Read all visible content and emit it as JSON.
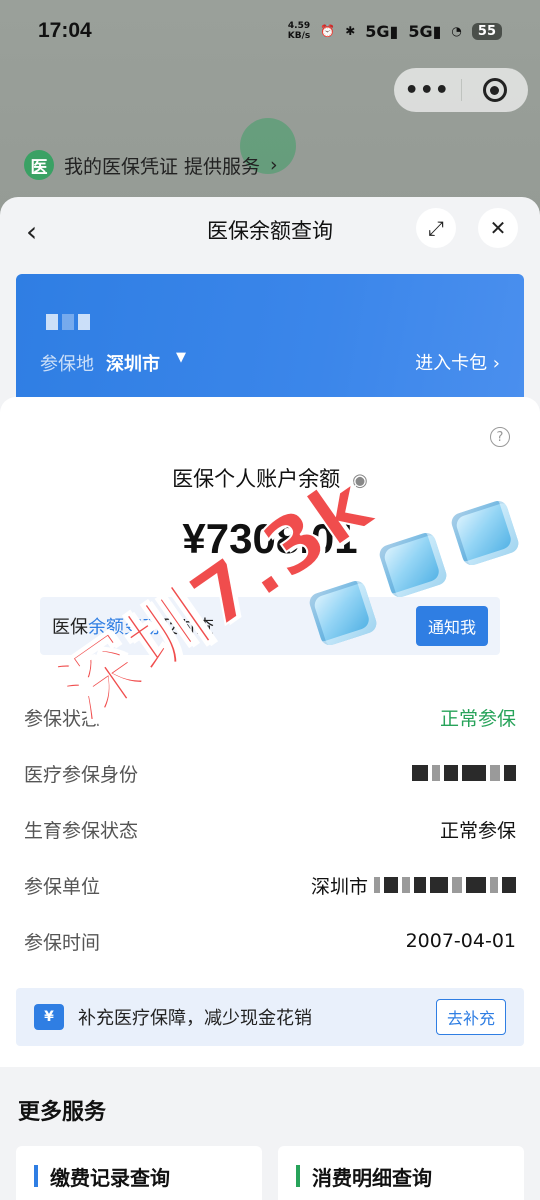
{
  "status_bar": {
    "time": "17:04",
    "net_speed_value": "4.59",
    "net_speed_unit": "KB/s",
    "signal_1": "5G",
    "signal_2": "5G",
    "battery": "55"
  },
  "capsule": {
    "more_icon": "more-dots-icon",
    "close_icon": "target-ring-icon"
  },
  "credential": {
    "icon_text": "医",
    "text": "我的医保凭证 提供服务"
  },
  "sheet": {
    "title": "医保余额查询",
    "back_icon": "chevron-left-icon",
    "expand_icon": "expand-arrows-icon",
    "close_icon": "close-icon"
  },
  "card": {
    "location_label": "参保地",
    "city": "深圳市",
    "wallet_link": "进入卡包"
  },
  "balance": {
    "label": "医保个人账户余额",
    "amount": "¥7308.01"
  },
  "notice": {
    "prefix": "医保",
    "highlight": "余额变动",
    "suffix": "及时查",
    "button": "通知我"
  },
  "details": [
    {
      "label": "参保状态",
      "value": "正常参保",
      "green": true
    },
    {
      "label": "医疗参保身份",
      "value": ""
    },
    {
      "label": "生育参保状态",
      "value": "正常参保"
    },
    {
      "label": "参保单位",
      "value": "深圳市"
    },
    {
      "label": "参保时间",
      "value": "2007-04-01"
    }
  ],
  "promo": {
    "icon_text": "¥",
    "text": "补充医疗保障，减少现金花销",
    "button": "去补充"
  },
  "more_services": {
    "title": "更多服务",
    "items": [
      {
        "label": "缴费记录查询",
        "accent": "#2f7ee3"
      },
      {
        "label": "消费明细查询",
        "accent": "#27a35a"
      }
    ]
  },
  "watermark": {
    "text": "深圳7.3k"
  },
  "colors": {
    "primary": "#2f7ee3",
    "success": "#27a35a",
    "stamp": "#f04d4d"
  }
}
